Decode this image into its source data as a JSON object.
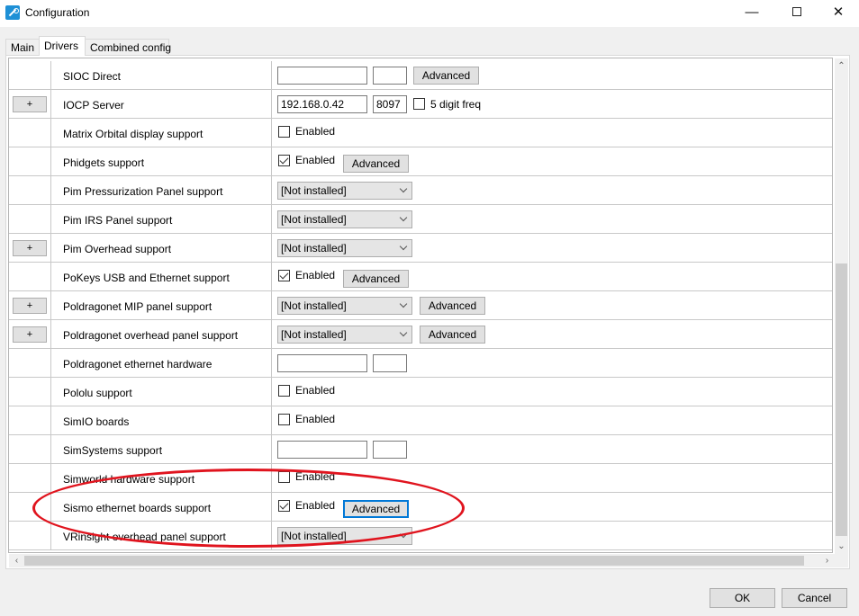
{
  "window": {
    "title": "Configuration",
    "minimize_glyph": "—",
    "close_glyph": "✕",
    "accent_color": "#0078d7"
  },
  "tabs": [
    {
      "label": "Main"
    },
    {
      "label": "Drivers",
      "selected": true
    },
    {
      "label": "Combined config"
    }
  ],
  "rows": [
    {
      "name": "SIOC Direct",
      "input1": "",
      "input2": "",
      "advanced": "Advanced"
    },
    {
      "expand": "+",
      "name": "IOCP Server",
      "input1": "192.168.0.42",
      "input2": "8097",
      "checkbox_label": "5 digit freq",
      "checked": false
    },
    {
      "name": "Matrix Orbital display support",
      "checkbox_label": "Enabled",
      "checked": false
    },
    {
      "name": "Phidgets support",
      "checkbox_label": "Enabled",
      "checked": true,
      "advanced": "Advanced"
    },
    {
      "name": "Pim Pressurization Panel support",
      "select": "[Not installed]"
    },
    {
      "name": "Pim IRS Panel support",
      "select": "[Not installed]"
    },
    {
      "expand": "+",
      "name": "Pim Overhead support",
      "select": "[Not installed]"
    },
    {
      "name": "PoKeys USB and Ethernet support",
      "checkbox_label": "Enabled",
      "checked": true,
      "advanced": "Advanced"
    },
    {
      "expand": "+",
      "name": "Poldragonet MIP panel support",
      "select": "[Not installed]",
      "advanced": "Advanced"
    },
    {
      "expand": "+",
      "name": "Poldragonet overhead panel support",
      "select": "[Not installed]",
      "advanced": "Advanced"
    },
    {
      "name": "Poldragonet ethernet hardware",
      "input1": "",
      "input2": ""
    },
    {
      "name": "Pololu support",
      "checkbox_label": "Enabled",
      "checked": false
    },
    {
      "name": "SimIO boards",
      "checkbox_label": "Enabled",
      "checked": false
    },
    {
      "name": "SimSystems support",
      "input1": "",
      "input2": ""
    },
    {
      "name": "Simworld hardware support",
      "checkbox_label": "Enabled",
      "checked": false
    },
    {
      "name": "Sismo ethernet boards support",
      "checkbox_label": "Enabled",
      "checked": true,
      "advanced": "Advanced",
      "focused": true
    },
    {
      "name": "VRinsight overhead panel support",
      "select": "[Not installed]"
    }
  ],
  "scroll": {
    "up": "⌃",
    "down": "⌄",
    "left": "‹",
    "right": "›"
  },
  "footer": {
    "ok_label": "OK",
    "cancel_label": "Cancel"
  },
  "annotation": {
    "color": "#e0141e"
  }
}
